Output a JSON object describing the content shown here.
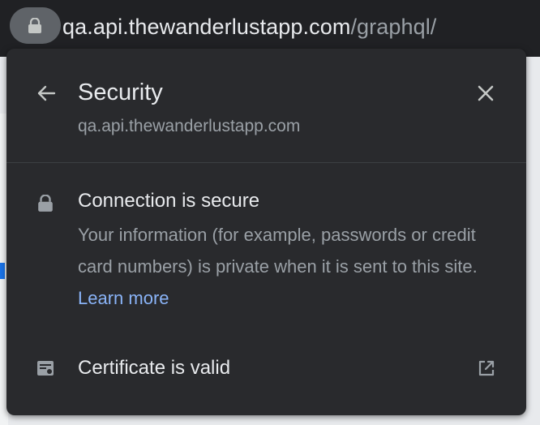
{
  "address_bar": {
    "lock_icon": "lock-icon",
    "url_domain": "qa.api.thewanderlustapp.com",
    "url_path": "/graphql/"
  },
  "popup": {
    "back_icon": "arrow-left-icon",
    "title": "Security",
    "subtitle": "qa.api.thewanderlustapp.com",
    "close_icon": "close-icon",
    "connection": {
      "icon": "lock-icon",
      "title": "Connection is secure",
      "description": "Your information (for example, passwords or credit card numbers) is private when it is sent to this site.",
      "learn_more": "Learn more"
    },
    "certificate": {
      "icon": "certificate-icon",
      "label": "Certificate is valid",
      "external_icon": "open-in-new-icon"
    }
  },
  "colors": {
    "popup_bg": "#292a2d",
    "primary_text": "#e8eaed",
    "secondary_text": "#9aa0a6",
    "link": "#8ab4f8",
    "chip_bg": "#5f6368"
  }
}
